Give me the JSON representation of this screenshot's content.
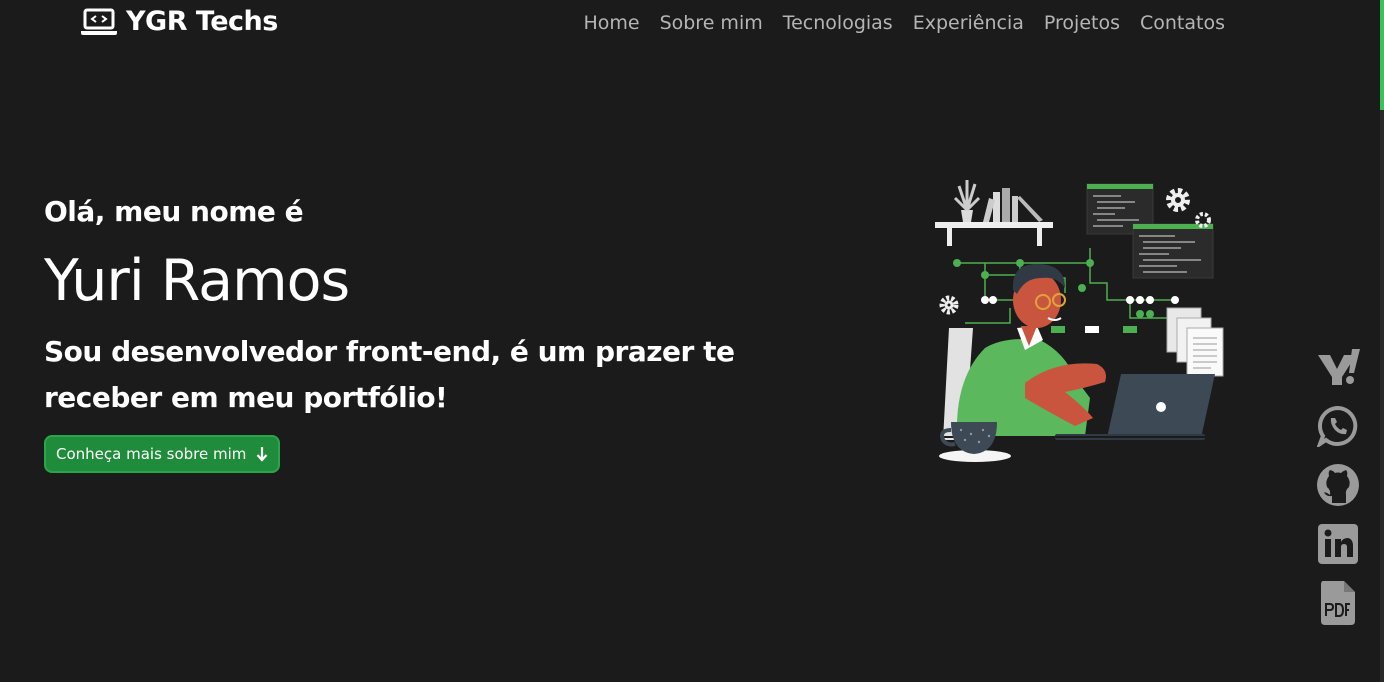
{
  "brand": {
    "name": "YGR Techs",
    "icon": "laptop-code-icon"
  },
  "nav": [
    {
      "label": "Home"
    },
    {
      "label": "Sobre mim"
    },
    {
      "label": "Tecnologias"
    },
    {
      "label": "Experiência"
    },
    {
      "label": "Projetos"
    },
    {
      "label": "Contatos"
    }
  ],
  "hero": {
    "greeting": "Olá, meu nome é",
    "name": "Yuri Ramos",
    "tagline_line1": "Sou desenvolvedor front-end, é um prazer te",
    "tagline_line2": "receber em meu portfólio!",
    "cta_label": "Conheça mais sobre mim",
    "cta_icon": "arrow-down-icon"
  },
  "socials": [
    {
      "name": "yahoo",
      "icon": "yahoo-icon"
    },
    {
      "name": "whatsapp",
      "icon": "whatsapp-icon"
    },
    {
      "name": "github",
      "icon": "github-icon"
    },
    {
      "name": "linkedin",
      "icon": "linkedin-icon"
    },
    {
      "name": "pdf",
      "icon": "pdf-file-icon"
    }
  ],
  "colors": {
    "background": "#1b1b1b",
    "accent": "#2aa64a",
    "nav_text": "#b5b5b5",
    "icon_gray": "#9a9a9a"
  }
}
